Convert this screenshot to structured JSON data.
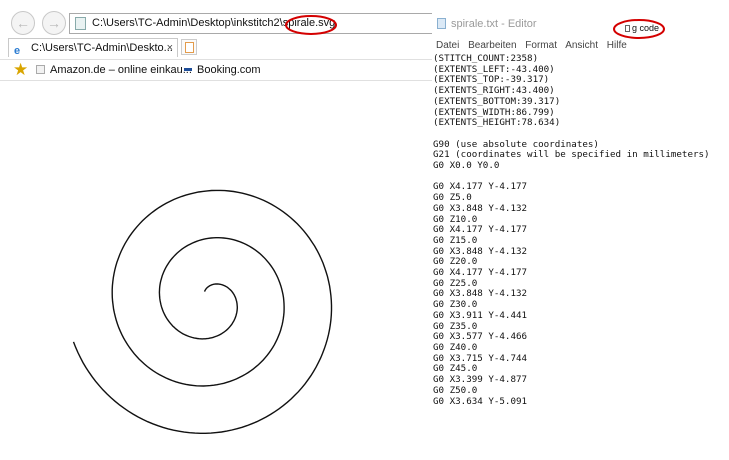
{
  "browser": {
    "address": "C:\\Users\\TC-Admin\\Desktop\\inkstitch2\\spirale.svg",
    "tab_title": "C:\\Users\\TC-Admin\\Deskto...",
    "tab_close": "×",
    "nav_back_icon": "back-arrow-icon",
    "nav_forward_icon": "forward-arrow-icon",
    "favorites": [
      {
        "label": "Amazon.de – online einkau...",
        "icon": "amazon-icon"
      },
      {
        "label": "Booking.com",
        "icon": "booking-icon"
      }
    ]
  },
  "editor": {
    "title": "spirale.txt - Editor",
    "menu": [
      "Datei",
      "Bearbeiten",
      "Format",
      "Ansicht",
      "Hilfe"
    ],
    "code_lines": [
      "(STITCH_COUNT:2358)",
      "(EXTENTS_LEFT:-43.400)",
      "(EXTENTS_TOP:-39.317)",
      "(EXTENTS_RIGHT:43.400)",
      "(EXTENTS_BOTTOM:39.317)",
      "(EXTENTS_WIDTH:86.799)",
      "(EXTENTS_HEIGHT:78.634)",
      "",
      "G90 (use absolute coordinates)",
      "G21 (coordinates will be specified in millimeters)",
      "G0 X0.0 Y0.0",
      "",
      "G0 X4.177 Y-4.177",
      "G0 Z5.0",
      "G0 X3.848 Y-4.132",
      "G0 Z10.0",
      "G0 X4.177 Y-4.177",
      "G0 Z15.0",
      "G0 X3.848 Y-4.132",
      "G0 Z20.0",
      "G0 X4.177 Y-4.177",
      "G0 Z25.0",
      "G0 X3.848 Y-4.132",
      "G0 Z30.0",
      "G0 X3.911 Y-4.441",
      "G0 Z35.0",
      "G0 X3.577 Y-4.466",
      "G0 Z40.0",
      "G0 X3.715 Y-4.744",
      "G0 Z45.0",
      "G0 X3.399 Y-4.877",
      "G0 Z50.0",
      "G0 X3.634 Y-5.091"
    ]
  },
  "annotation": {
    "gcode_label": "g code",
    "circle_color": "#d40000"
  }
}
